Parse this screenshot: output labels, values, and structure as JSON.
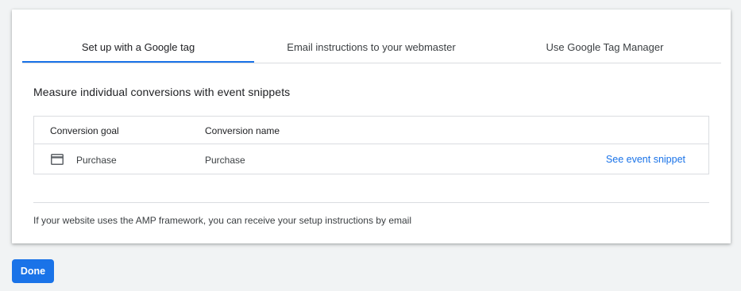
{
  "tabs": [
    {
      "label": "Set up with a Google tag",
      "active": true
    },
    {
      "label": "Email instructions to your webmaster",
      "active": false
    },
    {
      "label": "Use Google Tag Manager",
      "active": false
    }
  ],
  "section_title": "Measure individual conversions with event snippets",
  "table": {
    "headers": {
      "goal": "Conversion goal",
      "name": "Conversion name"
    },
    "rows": [
      {
        "icon": "credit-card-icon",
        "goal": "Purchase",
        "name": "Purchase",
        "action": "See event snippet"
      }
    ]
  },
  "amp_note": "If your website uses the AMP framework, you can receive your setup instructions by email",
  "done_label": "Done",
  "colors": {
    "accent": "#1a73e8",
    "background": "#f1f3f4",
    "border": "#dadce0"
  }
}
